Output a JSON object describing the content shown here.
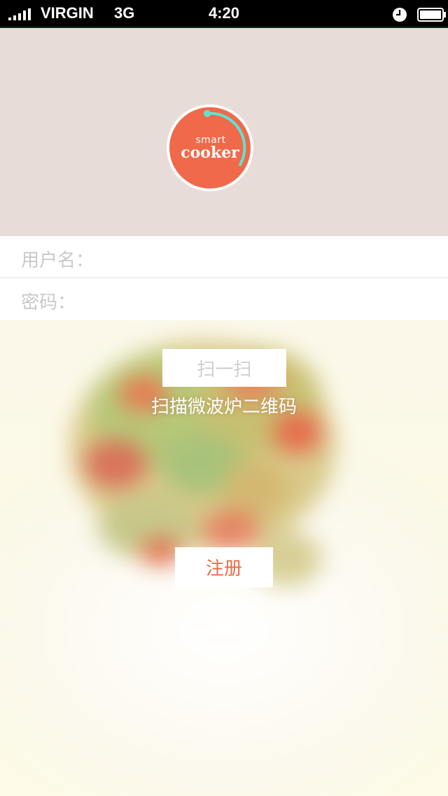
{
  "status_bar": {
    "carrier": "VIRGIN",
    "network": "3G",
    "time": "4:20",
    "icons": [
      "signal-icon",
      "clock-icon",
      "battery-icon"
    ]
  },
  "logo": {
    "line1": "smart",
    "line2": "cooker",
    "colors": {
      "circle": "#f0694a",
      "ring": "#ffffff",
      "arc": "#5fe3d0"
    }
  },
  "form": {
    "username_label": "用户名：",
    "username_value": "",
    "password_label": "密码：",
    "password_value": ""
  },
  "scan": {
    "button_label": "扫一扫",
    "caption": "扫描微波炉二维码"
  },
  "register": {
    "button_label": "注册"
  },
  "colors": {
    "header_bg": "#e8dcd9",
    "accent": "#ee6a45",
    "placeholder_text": "#c9c9c9"
  }
}
